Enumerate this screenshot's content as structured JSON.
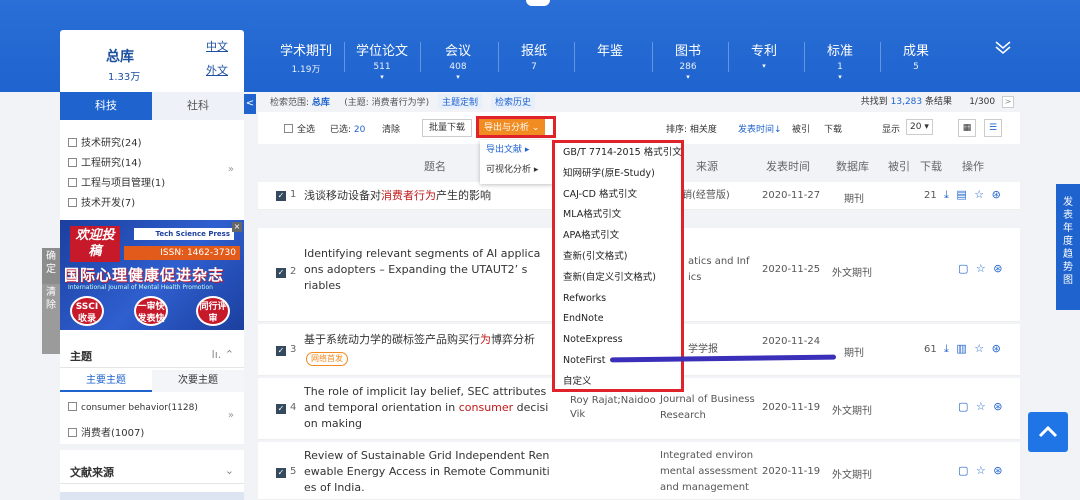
{
  "db_card": {
    "name": "总库",
    "count": "1.33万",
    "link_cn": "中文",
    "link_en": "外文"
  },
  "nav": [
    {
      "title": "学术期刊",
      "sub": "1.19万"
    },
    {
      "title": "学位论文",
      "sub": "511"
    },
    {
      "title": "会议",
      "sub": "408"
    },
    {
      "title": "报纸",
      "sub": "7"
    },
    {
      "title": "年鉴",
      "sub": ""
    },
    {
      "title": "图书",
      "sub": "286"
    },
    {
      "title": "专利",
      "sub": ""
    },
    {
      "title": "标准",
      "sub": "1"
    },
    {
      "title": "成果",
      "sub": "5"
    }
  ],
  "left_mark": {
    "text1": "确定",
    "text2": "清除"
  },
  "sidebar": {
    "tab_active": "科技",
    "tab_other": "社科",
    "items": [
      "技术研究(24)",
      "工程研究(14)",
      "工程与项目管理(1)",
      "技术开发(7)"
    ],
    "ad": {
      "welcome": "欢迎投稿",
      "press": "Tech Science Press",
      "issn": "ISSN: 1462-3730",
      "title": "国际心理健康促进杂志",
      "subtitle": "International Journal of Mental Health Promotion",
      "c1": "SSCI收录",
      "c2": "一审快发表快",
      "c3": "同行评审",
      "close": "×"
    },
    "topic": {
      "label": "主题",
      "sub_active": "主要主题",
      "sub_other": "次要主题",
      "items": [
        "consumer behavior(1128)",
        "消费者(1007)"
      ]
    },
    "source": {
      "label": "文献来源"
    }
  },
  "collapse": "<",
  "main": {
    "scope_label": "检索范围:",
    "scope_value": "总库",
    "query": "(主题: 消费者行为学)",
    "chip1": "主题定制",
    "chip2": "检索历史",
    "found_prefix": "共找到",
    "found_count": "13,283",
    "found_suffix": "条结果",
    "page": "1/300",
    "next": ">",
    "select_all": "全选",
    "selected_label": "已选:",
    "selected_count": "20",
    "clear": "清除",
    "batch_download": "批量下载",
    "export": "导出与分析 ⌄",
    "sort_label": "排序: 相关度",
    "sort_time": "发表时间↓",
    "sort_cite": "被引",
    "sort_dl": "下载",
    "show_label": "显示",
    "show_value": "20 ▾",
    "headers": {
      "title": "题名",
      "source": "来源",
      "date": "发表时间",
      "db": "数据库",
      "cite": "被引",
      "dl": "下载",
      "ops": "操作"
    }
  },
  "rows": [
    {
      "n": "1",
      "title_pre": "浅谈移动设备对",
      "title_red": "消费者行为",
      "title_post": "产生的影响",
      "source": "销(经营版)",
      "date": "2020-11-27",
      "db": "期刊",
      "dl": "21",
      "ops": "⤓ ▤ ☆ ⊛"
    },
    {
      "n": "2",
      "line1": "Identifying relevant segments of AI applica",
      "line2": "ons adopters – Expanding the UTAUT2’ s  ",
      "line3": "riables",
      "source1": "atics and Inf",
      "source2": "ics",
      "date": "2020-11-25",
      "db": "外文期刊",
      "ops": "▢ ☆ ⊛"
    },
    {
      "n": "3",
      "title_pre": "基于系统动力学的碳标签产品购买行",
      "title_red": "为",
      "title_post": "博弈分析",
      "tag": "网络首发",
      "source": "学学报",
      "date": "2020-11-24",
      "db": "期刊",
      "dl": "61",
      "ops": "⤓ ▥ ☆ ⊛"
    },
    {
      "n": "4",
      "line1": "The role of implicit lay belief, SEC attributes",
      "line2_pre": "and temporal orientation in ",
      "line2_red": "consumer",
      "line2_post": " decisi",
      "line3": "on making",
      "author1": "Roy Rajat;Naidoo",
      "author2": "Vik",
      "source1": "Journal of Business",
      "source2": "Research",
      "date": "2020-11-19",
      "db": "外文期刊",
      "ops": "▢ ☆ ⊛"
    },
    {
      "n": "5",
      "line1": "Review of Sustainable Grid Independent Ren",
      "line2": "ewable Energy Access in Remote Communiti",
      "line3": "es of India.",
      "source1": "Integrated environ",
      "source2": "mental assessment",
      "source3": "and management",
      "date": "2020-11-19",
      "db": "外文期刊",
      "ops": "▢ ☆ ⊛"
    }
  ],
  "dropdown1": [
    "导出文献 ▸",
    "可视化分析 ▸"
  ],
  "dropdown2": [
    "GB/T 7714-2015 格式引文",
    "知网研学(原E-Study)",
    "CAJ-CD 格式引文",
    "MLA格式引文",
    "APA格式引文",
    "查新(引文格式)",
    "查新(自定义引文格式)",
    "Refworks",
    "EndNote",
    "NoteExpress",
    "NoteFirst",
    "自定义"
  ],
  "rightbar": "发表年度趋势图"
}
